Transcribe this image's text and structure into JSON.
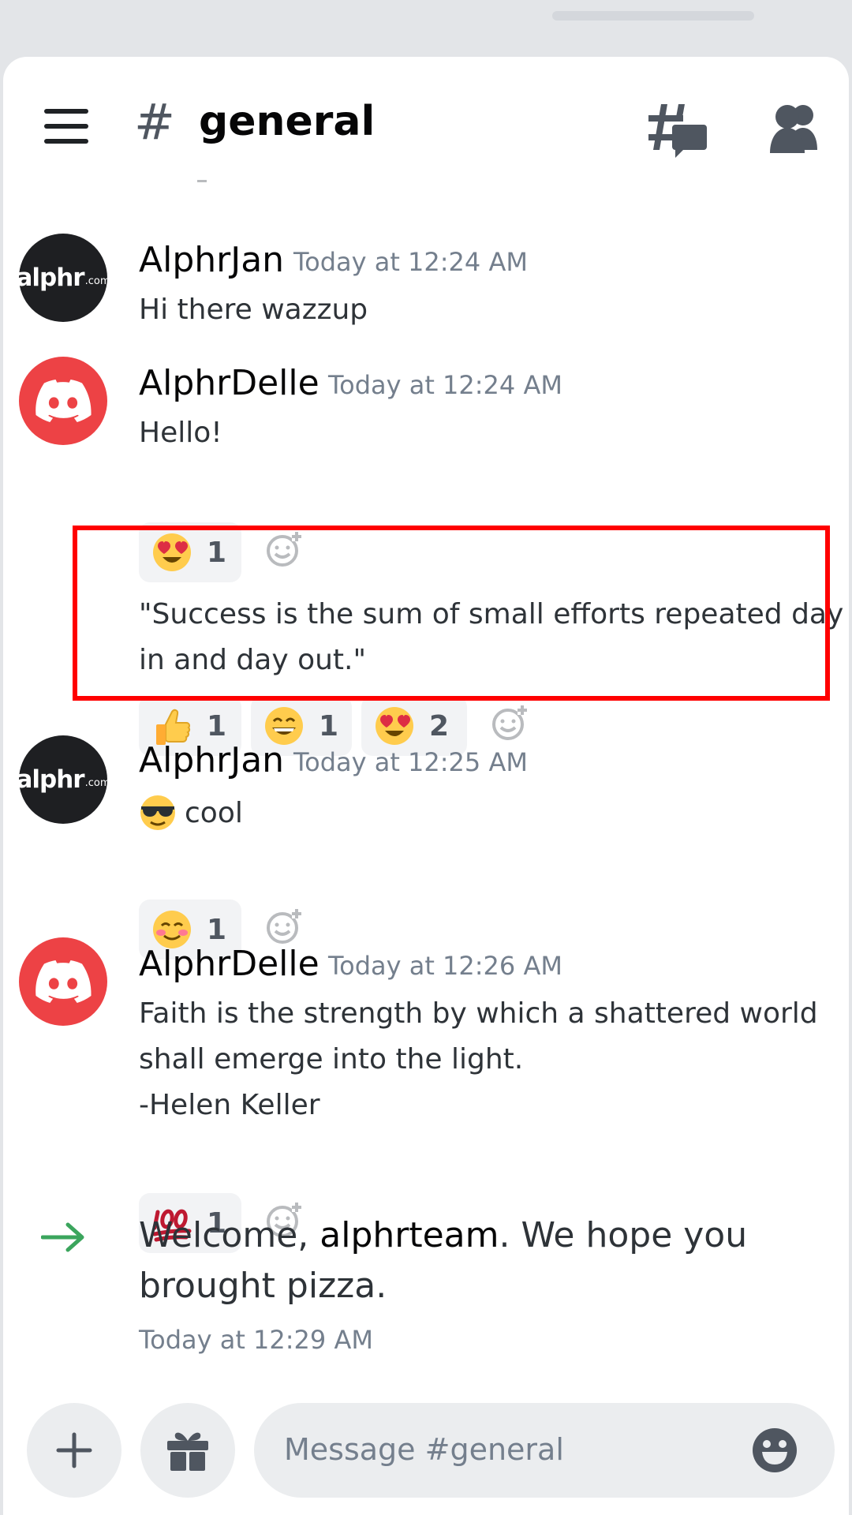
{
  "channel": {
    "hash": "#",
    "name": "general"
  },
  "messages": [
    {
      "author": "AlphrJan",
      "timestamp": "Today at 12:24 AM",
      "avatar": "alphr",
      "lines": [
        "Hi there wazzup"
      ]
    },
    {
      "author": "AlphrDelle",
      "timestamp": "Today at 12:24 AM",
      "avatar": "discord",
      "lines": [
        "Hello!"
      ],
      "reactions": [
        {
          "emoji": "heart-eyes",
          "count": "1"
        }
      ]
    },
    {
      "author": "AlphrDelle",
      "continuation": true,
      "lines": [
        "\"Success is the sum of small efforts repeated day",
        "in and day out.\""
      ],
      "reactions": [
        {
          "emoji": "thumbs-up",
          "count": "1"
        },
        {
          "emoji": "grin",
          "count": "1"
        },
        {
          "emoji": "heart-eyes",
          "count": "2"
        }
      ]
    },
    {
      "author": "AlphrJan",
      "timestamp": "Today at 12:25 AM",
      "avatar": "alphr",
      "lines": [
        "cool"
      ],
      "lead_emoji": "sunglasses",
      "reactions": [
        {
          "emoji": "blush",
          "count": "1"
        }
      ]
    },
    {
      "author": "AlphrDelle",
      "timestamp": "Today at 12:26 AM",
      "avatar": "discord",
      "lines": [
        "Faith is the strength by which a shattered world",
        "shall emerge into the light.",
        "-Helen Keller"
      ],
      "reactions": [
        {
          "emoji": "hundred-points",
          "count": "1"
        }
      ]
    }
  ],
  "alphr_logo": {
    "main": "alphr",
    "sub": ".com"
  },
  "welcome": {
    "before": "Welcome, ",
    "user": "alphrteam",
    "after": ". We hope you",
    "line2": "brought pizza.",
    "timestamp": "Today at 12:29 AM"
  },
  "composer": {
    "placeholder": "Message #general"
  },
  "colors": {
    "highlight": "#ff0000",
    "discord_red": "#ed4245",
    "welcome_arrow": "#3ba55d"
  }
}
